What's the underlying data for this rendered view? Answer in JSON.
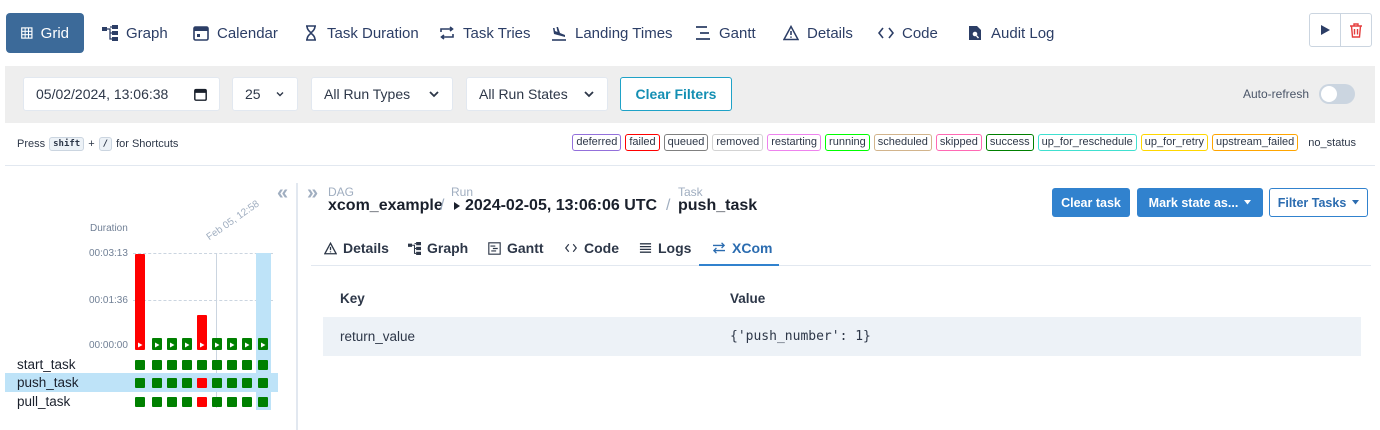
{
  "nav": {
    "tabs": [
      {
        "label": "Grid",
        "icon": "grid-icon",
        "active": true
      },
      {
        "label": "Graph",
        "icon": "graph-icon"
      },
      {
        "label": "Calendar",
        "icon": "calendar-icon"
      },
      {
        "label": "Task Duration",
        "icon": "hourglass-icon"
      },
      {
        "label": "Task Tries",
        "icon": "repeat-icon"
      },
      {
        "label": "Landing Times",
        "icon": "plane-landing-icon"
      },
      {
        "label": "Gantt",
        "icon": "gantt-icon"
      },
      {
        "label": "Details",
        "icon": "warning-icon"
      },
      {
        "label": "Code",
        "icon": "code-icon"
      },
      {
        "label": "Audit Log",
        "icon": "audit-log-icon"
      }
    ],
    "action_icons": [
      "play-icon",
      "trash-icon"
    ]
  },
  "filters": {
    "date_value": "05/02/2024, 13:06:38",
    "num_runs": "25",
    "run_types": "All Run Types",
    "run_states": "All Run States",
    "clear_label": "Clear Filters",
    "auto_refresh_label": "Auto-refresh",
    "auto_refresh_on": false
  },
  "shortcuts": {
    "press": "Press",
    "key1": "shift",
    "plus": "+",
    "key2": "/",
    "suffix": "for Shortcuts"
  },
  "legend": [
    {
      "label": "deferred",
      "color": "#9370db"
    },
    {
      "label": "failed",
      "color": "#ff0000"
    },
    {
      "label": "queued",
      "color": "#808080"
    },
    {
      "label": "removed",
      "color": "#d3d3d3"
    },
    {
      "label": "restarting",
      "color": "#ee82ee"
    },
    {
      "label": "running",
      "color": "#00ff00"
    },
    {
      "label": "scheduled",
      "color": "#d2b48c"
    },
    {
      "label": "skipped",
      "color": "#ff69b4"
    },
    {
      "label": "success",
      "color": "#008000"
    },
    {
      "label": "up_for_reschedule",
      "color": "#40e0d0"
    },
    {
      "label": "up_for_retry",
      "color": "#ffd700"
    },
    {
      "label": "upstream_failed",
      "color": "#ffa500"
    }
  ],
  "no_status_label": "no_status",
  "grid": {
    "duration_label": "Duration",
    "ticks": [
      "00:03:13",
      "00:01:36",
      "00:00:00"
    ],
    "date_label": "Feb 05, 12:58",
    "run_statuses": [
      "failed",
      "success",
      "success",
      "success",
      "failed",
      "success",
      "success",
      "success",
      "success"
    ],
    "run_durations_sec": [
      193,
      8,
      8,
      8,
      71,
      8,
      8,
      8,
      8
    ],
    "tasks": [
      {
        "name": "start_task",
        "states": [
          "success",
          "success",
          "success",
          "success",
          "success",
          "success",
          "success",
          "success",
          "success"
        ]
      },
      {
        "name": "push_task",
        "states": [
          "success",
          "success",
          "success",
          "success",
          "failed",
          "success",
          "success",
          "success",
          "success"
        ]
      },
      {
        "name": "pull_task",
        "states": [
          "success",
          "success",
          "success",
          "success",
          "failed",
          "success",
          "success",
          "success",
          "success"
        ]
      }
    ]
  },
  "breadcrumb": {
    "dag_key": "DAG",
    "dag": "xcom_example",
    "run_key": "Run",
    "run": "2024-02-05, 13:06:06 UTC",
    "task_key": "Task",
    "task": "push_task"
  },
  "actions": {
    "clear_task": "Clear task",
    "mark_state": "Mark state as...",
    "filter_tasks": "Filter Tasks"
  },
  "detail_tabs": [
    {
      "label": "Details",
      "icon": "warning-icon"
    },
    {
      "label": "Graph",
      "icon": "graph-icon"
    },
    {
      "label": "Gantt",
      "icon": "gantt-icon"
    },
    {
      "label": "Code",
      "icon": "code-icon"
    },
    {
      "label": "Logs",
      "icon": "logs-icon"
    },
    {
      "label": "XCom",
      "icon": "exchange-icon",
      "active": true
    }
  ],
  "xcom": {
    "headers": [
      "Key",
      "Value"
    ],
    "rows": [
      {
        "key": "return_value",
        "value": "{'push_number': 1}"
      }
    ]
  }
}
